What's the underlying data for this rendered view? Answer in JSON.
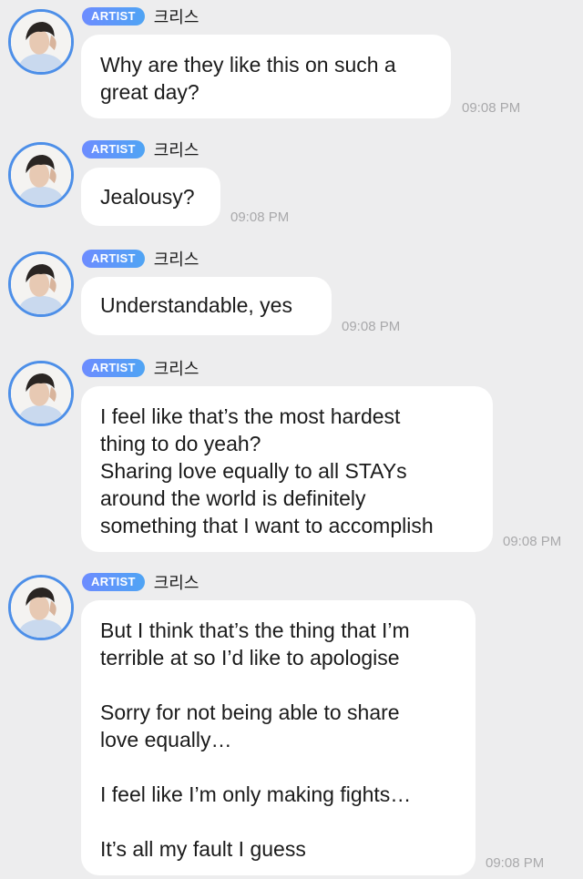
{
  "chat": {
    "messages": [
      {
        "badge": "ARTIST",
        "name": "크리스",
        "lines": [
          "Why are they like this on such a",
          "great day?"
        ],
        "time": "09:08 PM"
      },
      {
        "badge": "ARTIST",
        "name": "크리스",
        "lines": [
          "Jealousy?"
        ],
        "time": "09:08 PM"
      },
      {
        "badge": "ARTIST",
        "name": "크리스",
        "lines": [
          "Understandable, yes"
        ],
        "time": "09:08 PM"
      },
      {
        "badge": "ARTIST",
        "name": "크리스",
        "lines": [
          "I feel like that’s the most hardest",
          "thing to do yeah?",
          "Sharing love equally to all STAYs",
          "around the world is definitely",
          "something that I want to accomplish"
        ],
        "time": "09:08 PM"
      },
      {
        "badge": "ARTIST",
        "name": "크리스",
        "lines": [
          "But I think that’s the thing that I’m",
          "terrible at so I’d like to apologise",
          "",
          "Sorry for not being able to share",
          "love equally…",
          "",
          "I feel like I’m only making fights…",
          "",
          "It’s all my fault I guess"
        ],
        "time": "09:08 PM"
      }
    ]
  }
}
